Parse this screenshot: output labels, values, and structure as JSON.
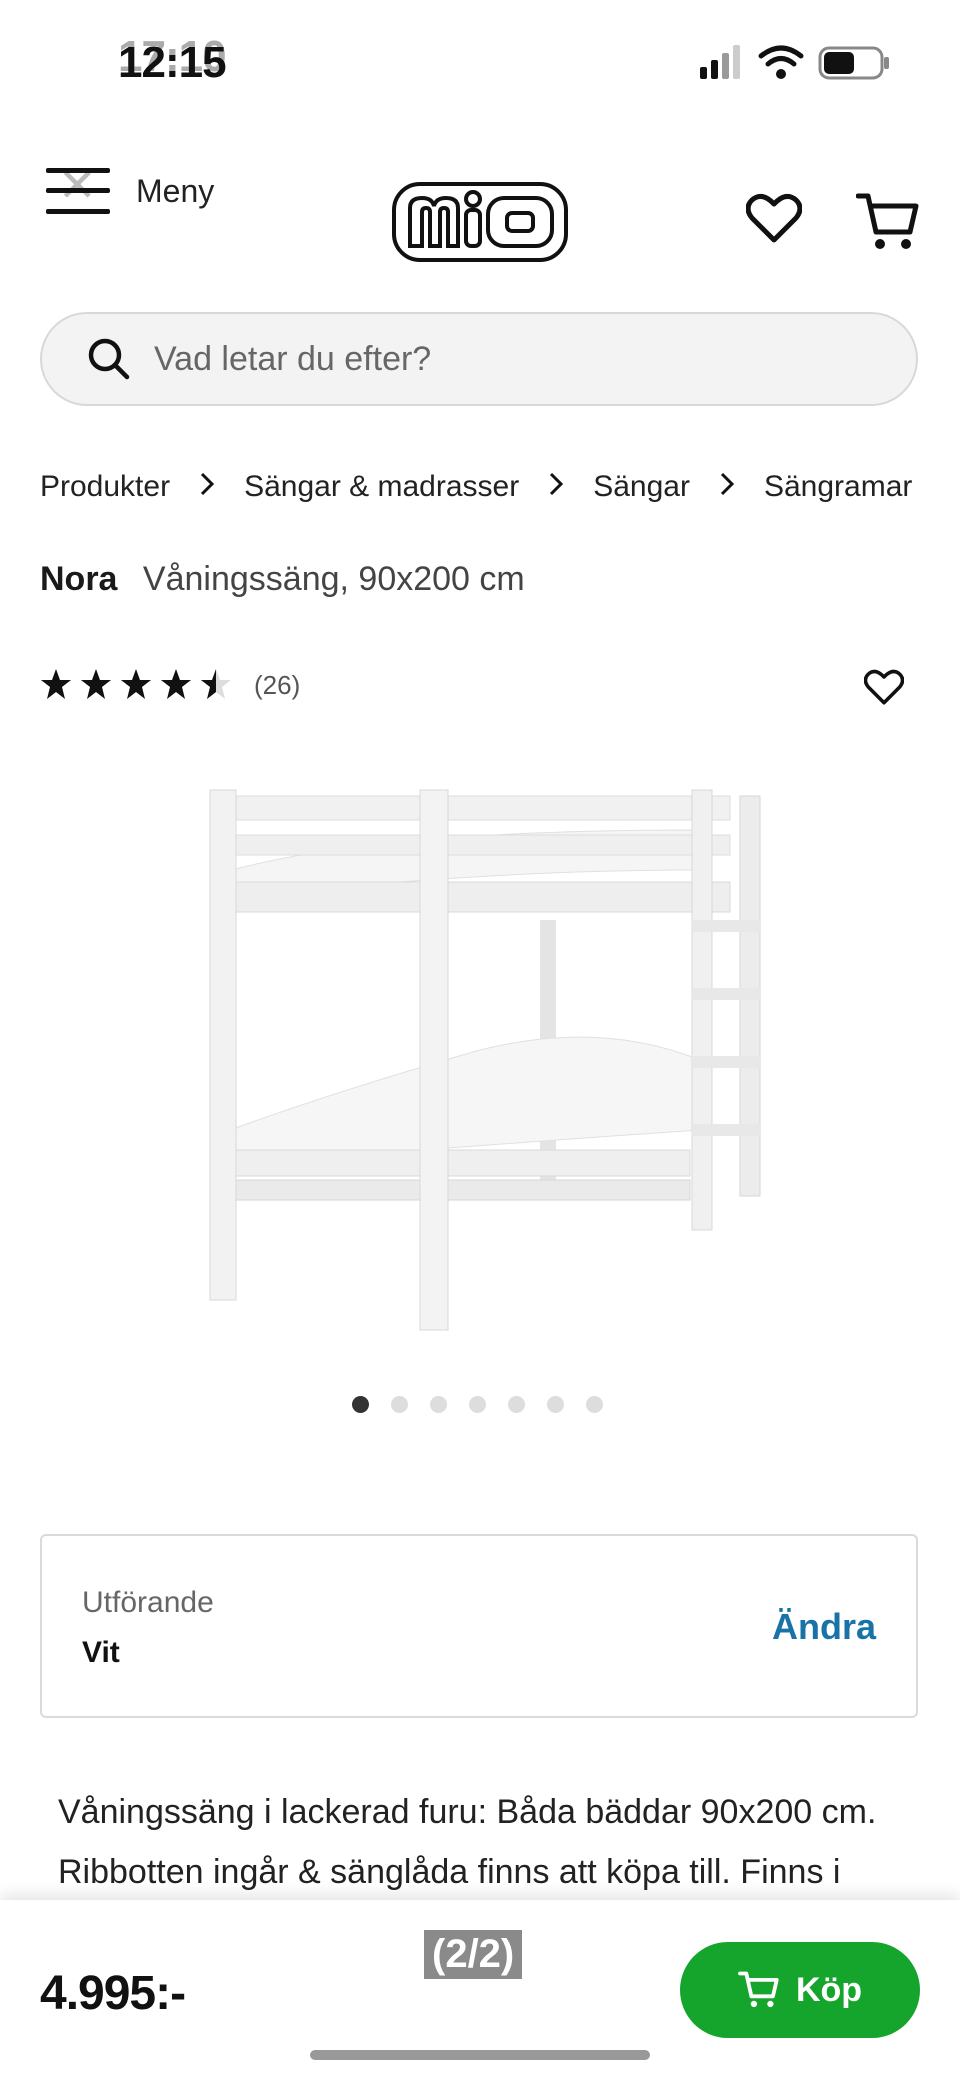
{
  "status": {
    "time": "12:15",
    "time_overlay": "17:10"
  },
  "header": {
    "menu_label": "Meny",
    "logo_text": "MiO"
  },
  "search": {
    "placeholder": "Vad letar du efter?"
  },
  "breadcrumb": [
    "Produkter",
    "Sängar & madrasser",
    "Sängar",
    "Sängramar"
  ],
  "product": {
    "name": "Nora",
    "subtitle": "Våningssäng, 90x200 cm",
    "rating": 4.5,
    "review_count": "(26)",
    "image_count": 7,
    "active_image": 0
  },
  "variant": {
    "label": "Utförande",
    "value": "Vit",
    "change_label": "Ändra"
  },
  "description": "Våningssäng i lackerad furu: Båda bäddar 90x200 cm. Ribbotten ingår & sänglåda finns att köpa till. Finns i",
  "footer": {
    "price": "4.995:-",
    "page_indicator": "(2/2)",
    "buy_label": "Köp"
  },
  "colors": {
    "buy_green": "#16a52c",
    "link_blue": "#1a73a8"
  }
}
